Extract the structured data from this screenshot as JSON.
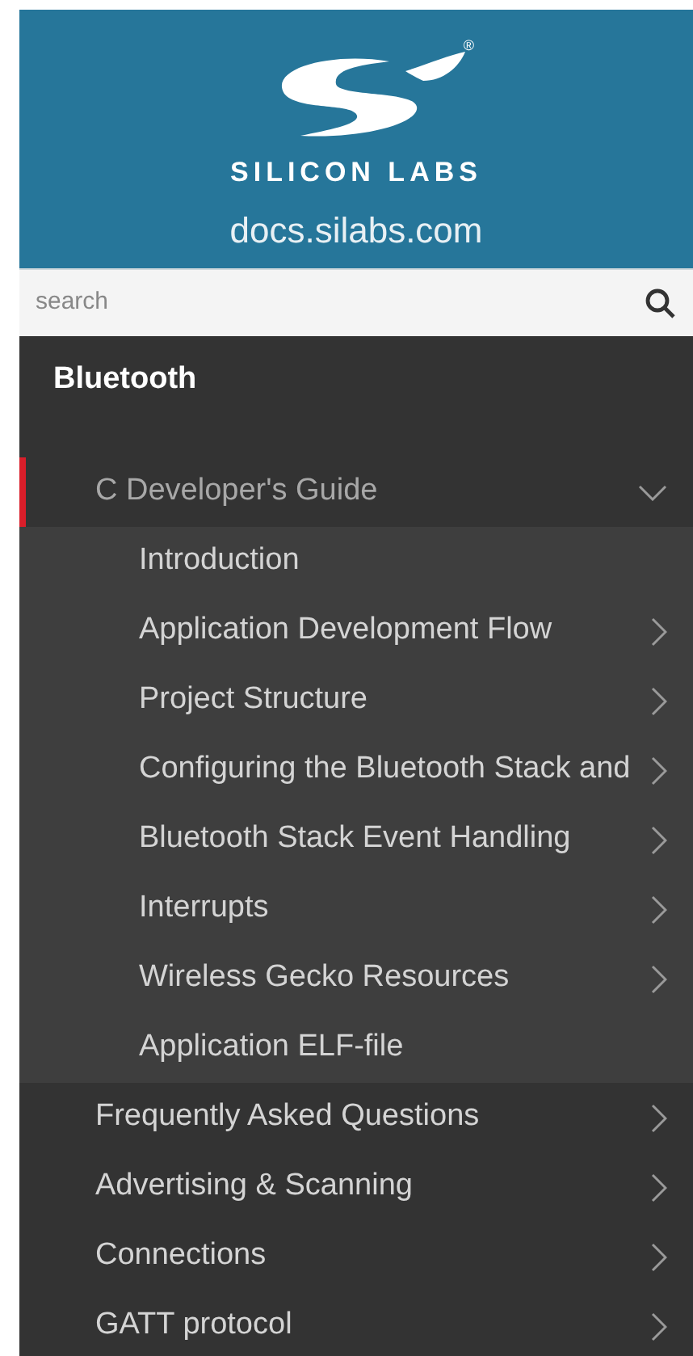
{
  "header": {
    "brand": "SILICON LABS",
    "registered_mark": "®",
    "site": "docs.silabs.com"
  },
  "search": {
    "placeholder": "search"
  },
  "section": {
    "title": "Bluetooth"
  },
  "nav": [
    {
      "label": "C Developer's Guide",
      "has_children": true,
      "expanded": true,
      "selected": true,
      "children": [
        {
          "label": "Introduction",
          "has_children": false
        },
        {
          "label": "Application Development Flow",
          "has_children": true
        },
        {
          "label": "Project Structure",
          "has_children": true
        },
        {
          "label": "Configuring the Bluetooth Stack and",
          "has_children": true
        },
        {
          "label": "Bluetooth Stack Event Handling",
          "has_children": true
        },
        {
          "label": "Interrupts",
          "has_children": true
        },
        {
          "label": "Wireless Gecko Resources",
          "has_children": true
        },
        {
          "label": "Application ELF-file",
          "has_children": false
        }
      ]
    },
    {
      "label": "Frequently Asked Questions",
      "has_children": true,
      "expanded": false,
      "selected": false
    },
    {
      "label": "Advertising & Scanning",
      "has_children": true,
      "expanded": false,
      "selected": false
    },
    {
      "label": "Connections",
      "has_children": true,
      "expanded": false,
      "selected": false
    },
    {
      "label": "GATT protocol",
      "has_children": true,
      "expanded": false,
      "selected": false
    }
  ]
}
